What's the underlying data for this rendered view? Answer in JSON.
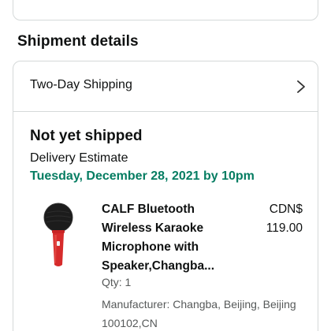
{
  "shipment": {
    "section_title": "Shipment details",
    "shipping_option": "Two-Day Shipping",
    "status": "Not yet shipped",
    "delivery_label": "Delivery Estimate",
    "delivery_date": "Tuesday, December 28, 2021 by 10pm",
    "item": {
      "title": "CALF Bluetooth Wireless Karaoke Microphone with Speaker,Changba...",
      "currency": "CDN$",
      "price": "119.00",
      "qty": "Qty: 1",
      "manufacturer": "Manufacturer: Changba, Beijing, Beijing 100102,CN",
      "image": "microphone-product-image"
    }
  },
  "colors": {
    "delivery_green": "#067d62",
    "border": "#d5d9d9",
    "secondary_text": "#565959"
  },
  "icons": {
    "chevron": "chevron-right-icon"
  }
}
